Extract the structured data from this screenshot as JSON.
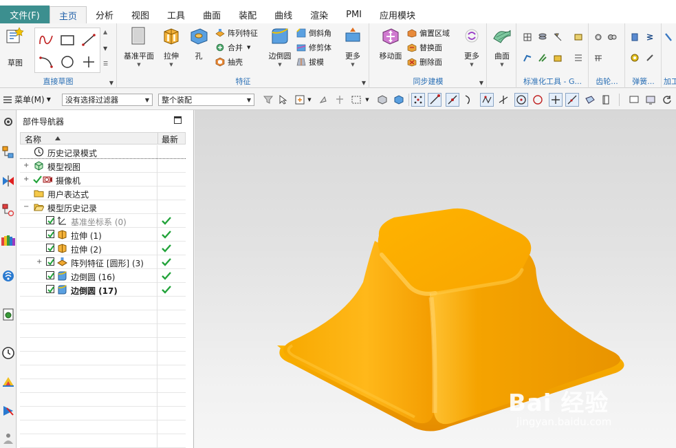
{
  "menu_tabs": {
    "file": "文件(F)",
    "home": "主页",
    "analysis": "分析",
    "view": "视图",
    "tools": "工具",
    "surface": "曲面",
    "assembly": "装配",
    "curve": "曲线",
    "render": "渲染",
    "pmi": "PMI",
    "app": "应用模块"
  },
  "ribbon": {
    "direct_sketch": {
      "label": "直接草图",
      "sketch_button": "草图"
    },
    "feature": {
      "label": "特征",
      "datum_plane": "基准平面",
      "extrude": "拉伸",
      "hole": "孔",
      "pattern_feature": "阵列特征",
      "unite": "合并",
      "shell": "抽壳",
      "edge_blend": "边倒圆",
      "chamfer": "倒斜角",
      "trim_body": "修剪体",
      "draft": "拔模",
      "more": "更多"
    },
    "sync_modeling": {
      "label": "同步建模",
      "move_face": "移动面",
      "offset_region": "偏置区域",
      "replace_face": "替换面",
      "delete_face": "删除面",
      "more": "更多"
    },
    "surface_group": {
      "surface": "曲面"
    },
    "std_tools": {
      "label": "标准化工具 - G..."
    },
    "gear": {
      "label": "齿轮..."
    },
    "spring": {
      "label": "弹簧..."
    },
    "machining": {
      "label": "加工"
    }
  },
  "toolbar": {
    "menu_label": "菜单(M)",
    "filter_value": "没有选择过滤器",
    "assembly_value": "整个装配"
  },
  "navigator": {
    "title": "部件导航器",
    "col_name": "名称",
    "col_latest": "最新",
    "rows": [
      {
        "label": "历史记录模式"
      },
      {
        "label": "模型视图"
      },
      {
        "label": "摄像机"
      },
      {
        "label": "用户表达式"
      },
      {
        "label": "模型历史记录"
      },
      {
        "label": "基准坐标系 (0)"
      },
      {
        "label": "拉伸 (1)"
      },
      {
        "label": "拉伸 (2)"
      },
      {
        "label": "阵列特征 [圆形] (3)"
      },
      {
        "label": "边倒圆 (16)"
      },
      {
        "label": "边倒圆 (17)"
      }
    ]
  },
  "watermark": {
    "brand": "Bai 经验",
    "url": "jingyan.baidu.com"
  },
  "colors": {
    "file_tab": "#3c8f8f",
    "accent_blue": "#2a6fb5",
    "model_orange": "#f5a300",
    "check_green": "#22a33a"
  }
}
